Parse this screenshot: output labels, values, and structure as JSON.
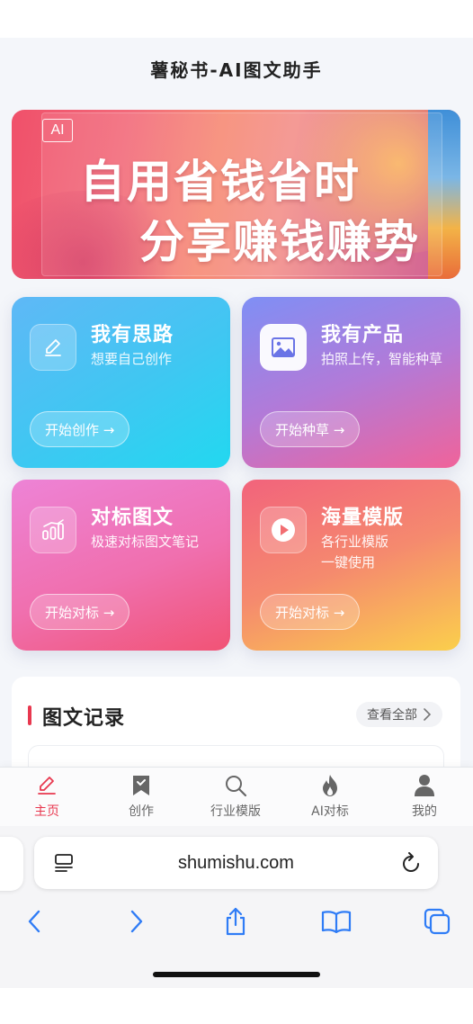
{
  "page": {
    "title": "薯秘书-AI图文助手"
  },
  "banner": {
    "tag": "AI",
    "line1": "自用省钱省时",
    "line2": "分享赚钱赚势"
  },
  "cards": [
    {
      "title": "我有思路",
      "desc": "想要自己创作",
      "button": "开始创作 →",
      "icon": "pencil-icon"
    },
    {
      "title": "我有产品",
      "desc": "拍照上传，智能种草",
      "button": "开始种草 →",
      "icon": "image-icon"
    },
    {
      "title": "对标图文",
      "desc": "极速对标图文笔记",
      "button": "开始对标 →",
      "icon": "bar-chart-icon"
    },
    {
      "title": "海量模版",
      "desc": "各行业模版\n一键使用",
      "button": "开始对标 →",
      "icon": "play-icon"
    }
  ],
  "records": {
    "title": "图文记录",
    "view_all": "查看全部",
    "view_all_icon": "chevron-right-icon"
  },
  "tabbar": {
    "items": [
      {
        "label": "主页",
        "icon": "pencil-icon",
        "active": true
      },
      {
        "label": "创作",
        "icon": "bookmark-icon",
        "active": false
      },
      {
        "label": "行业模版",
        "icon": "search-icon",
        "active": false
      },
      {
        "label": "AI对标",
        "icon": "flame-icon",
        "active": false
      },
      {
        "label": "我的",
        "icon": "user-icon",
        "active": false
      }
    ]
  },
  "browser": {
    "url": "shumishu.com",
    "icons": [
      "reader-icon",
      "reload-icon",
      "back-icon",
      "forward-icon",
      "share-icon",
      "bookmarks-icon",
      "tabs-icon"
    ]
  },
  "colors": {
    "accent": "#e8384f",
    "tab_inactive": "#666666"
  }
}
